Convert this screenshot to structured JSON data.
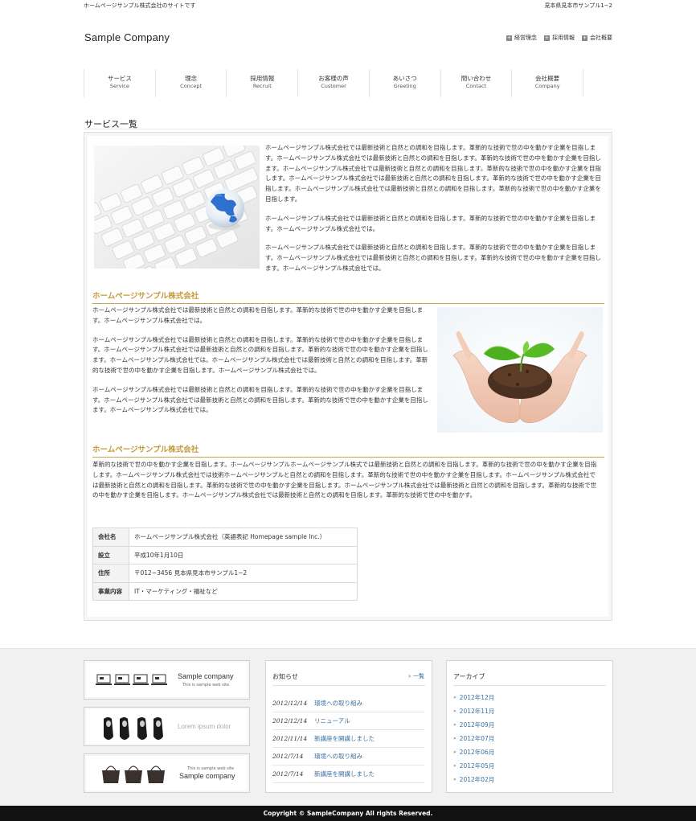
{
  "topbar": {
    "tagline": "ホームページサンプル株式会社のサイトです",
    "address": "見本県見本市サンプル1−2"
  },
  "header": {
    "logo": "Sample Company"
  },
  "utility_nav": [
    {
      "icon": "plus-square-icon",
      "label": "経営理念"
    },
    {
      "icon": "plus-square-icon",
      "label": "採用情報"
    },
    {
      "icon": "plus-square-icon",
      "label": "会社概要"
    }
  ],
  "global_nav": [
    {
      "ja": "サービス",
      "en": "Service"
    },
    {
      "ja": "理念",
      "en": "Concept"
    },
    {
      "ja": "採用情報",
      "en": "Recruit"
    },
    {
      "ja": "お客様の声",
      "en": "Customer"
    },
    {
      "ja": "あいさつ",
      "en": "Greeting"
    },
    {
      "ja": "問い合わせ",
      "en": "Contact"
    },
    {
      "ja": "会社概要",
      "en": "Company"
    }
  ],
  "page_title": "サービス一覧",
  "intro": {
    "paragraphs": [
      "ホームページサンプル株式会社では最新技術と自然との調和を目指します。革新的な技術で世の中を動かす企業を目指します。ホームページサンプル株式会社では最新技術と自然との調和を目指します。革新的な技術で世の中を動かす企業を目指します。ホームページサンプル株式会社では最新技術と自然との調和を目指します。革新的な技術で世の中を動かす企業を目指します。ホームページサンプル株式会社では最新技術と自然との調和を目指します。革新的な技術で世の中を動かす企業を目指します。ホームページサンプル株式会社では最新技術と自然との調和を目指します。革新的な技術で世の中を動かす企業を目指します。",
      "ホームページサンプル株式会社では最新技術と自然との調和を目指します。革新的な技術で世の中を動かす企業を目指します。ホームページサンプル株式会社では。",
      "ホームページサンプル株式会社では最新技術と自然との調和を目指します。革新的な技術で世の中を動かす企業を目指します。ホームページサンプル株式会社では最新技術と自然との調和を目指します。革新的な技術で世の中を動かす企業を目指します。ホームページサンプル株式会社では。"
    ]
  },
  "section1": {
    "heading": "ホームページサンプル株式会社",
    "paragraphs": [
      "ホームページサンプル株式会社では最新技術と自然との調和を目指します。革新的な技術で世の中を動かす企業を目指します。ホームページサンプル株式会社では。",
      "ホームページサンプル株式会社では最新技術と自然との調和を目指します。革新的な技術で世の中を動かす企業を目指します。ホームページサンプル株式会社では最新技術と自然との調和を目指します。革新的な技術で世の中を動かす企業を目指します。ホームページサンプル株式会社では。ホームページサンプル株式会社では最新技術と自然との調和を目指します。革新的な技術で世の中を動かす企業を目指します。ホームページサンプル株式会社では。",
      "ホームページサンプル株式会社では最新技術と自然との調和を目指します。革新的な技術で世の中を動かす企業を目指します。ホームページサンプル株式会社では最新技術と自然との調和を目指します。革新的な技術で世の中を動かす企業を目指します。ホームページサンプル株式会社では。"
    ]
  },
  "section2": {
    "heading": "ホームページサンプル株式会社",
    "paragraph": "革新的な技術で世の中を動かす企業を目指します。ホームページサンプルホームページサンプル株式では最新技術と自然との調和を目指します。革新的な技術で世の中を動かす企業を目指します。ホームページサンプル株式会社では技術ホームページサンプルと自然との調和を目指します。革新的な技術で世の中を動かす企業を目指します。ホームページサンプル株式会社では最新技術と自然との調和を目指します。革新的な技術で世の中を動かす企業を目指します。ホームページサンプル株式会社では最新技術と自然との調和を目指します。革新的な技術で世の中を動かす企業を目指します。ホームページサンプル株式会社では最新技術と自然との調和を目指します。革新的な技術で世の中を動かす。"
  },
  "company_table": [
    {
      "label": "会社名",
      "value": "ホームページサンプル株式会社（英語表記 Homepage sample Inc.）"
    },
    {
      "label": "設立",
      "value": "平成10年1月10日"
    },
    {
      "label": "住所",
      "value": "〒012−3456 見本県見本市サンプル1−2"
    },
    {
      "label": "事業内容",
      "value": "IT・マーケティング・福祉など"
    }
  ],
  "banners": [
    {
      "title": "Sample company",
      "sub": "This is sample web site"
    },
    {
      "title": "Lorem ipsum dolor"
    },
    {
      "small": "This is sample web site",
      "title": "Sample company"
    }
  ],
  "news": {
    "heading": "お知らせ",
    "more": "一覧",
    "items": [
      {
        "date": "2012/12/14",
        "title": "環境への取り組み"
      },
      {
        "date": "2012/12/14",
        "title": "リニューアル"
      },
      {
        "date": "2012/11/14",
        "title": "新講座を開講しました"
      },
      {
        "date": "2012/7/14",
        "title": "環境への取り組み"
      },
      {
        "date": "2012/7/14",
        "title": "新講座を開講しました"
      }
    ]
  },
  "archive": {
    "heading": "アーカイブ",
    "items": [
      "2012年12月",
      "2012年11月",
      "2012年09月",
      "2012年07月",
      "2012年06月",
      "2012年05月",
      "2012年02月"
    ]
  },
  "copyright": "Copyright © SampleCompany All rights Reserved."
}
